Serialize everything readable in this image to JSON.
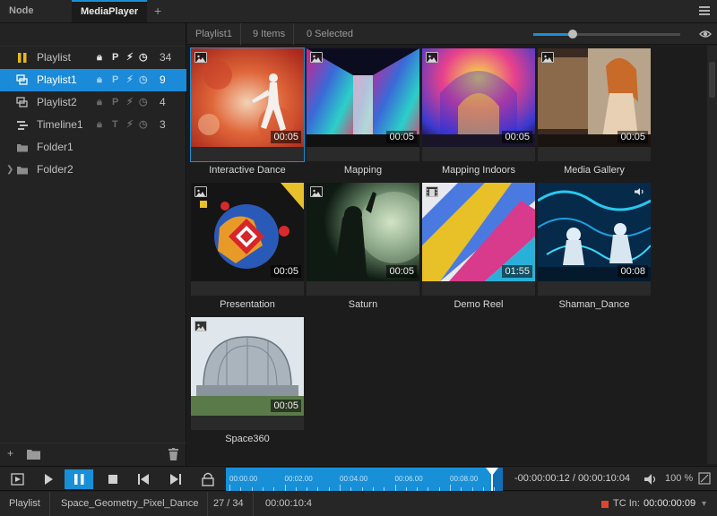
{
  "tabs": [
    {
      "label": "Node Graph"
    },
    {
      "label": "MediaPlayer"
    }
  ],
  "tab_add_label": "+",
  "sidebar": {
    "items": [
      {
        "label": "Playlist",
        "flags": [
          "lock",
          "P",
          "bolt",
          "clock"
        ],
        "count": "34"
      },
      {
        "label": "Playlist1",
        "flags": [
          "lock",
          "P",
          "bolt",
          "clock"
        ],
        "count": "9"
      },
      {
        "label": "Playlist2",
        "flags": [
          "lock",
          "P",
          "bolt",
          "clock"
        ],
        "count": "4"
      },
      {
        "label": "Timeline1",
        "flags": [
          "lock",
          "T",
          "bolt",
          "clock"
        ],
        "count": "3"
      },
      {
        "label": "Folder1"
      },
      {
        "label": "Folder2"
      }
    ],
    "footer_add": "+"
  },
  "header": {
    "playlist": "Playlist1",
    "items": "9 Items",
    "selected": "0 Selected",
    "thumb_size_level": 0.27
  },
  "media": [
    {
      "title": "Interactive Dance",
      "duration": "00:05",
      "kind": "image-icon"
    },
    {
      "title": "Mapping",
      "duration": "00:05",
      "kind": "image-icon"
    },
    {
      "title": "Mapping Indoors",
      "duration": "00:05",
      "kind": "image-icon"
    },
    {
      "title": "Media Gallery",
      "duration": "00:05",
      "kind": "image-icon"
    },
    {
      "title": "Presentation",
      "duration": "00:05",
      "kind": "image-icon"
    },
    {
      "title": "Saturn",
      "duration": "00:05",
      "kind": "image-icon"
    },
    {
      "title": "Demo Reel",
      "duration": "01:55",
      "kind": "film-icon"
    },
    {
      "title": "Shaman_Dance",
      "duration": "00:08",
      "kind": "audio-icon"
    },
    {
      "title": "Space360",
      "duration": "00:05",
      "kind": "image-icon"
    }
  ],
  "transport": {
    "ticks": [
      "00:00.00",
      "00:02.00",
      "00:04.00",
      "00:06.00",
      "00:08.00"
    ],
    "progress": 0.96,
    "timecode": "-00:00:00:12 / 00:00:10:04",
    "volume": "100 %"
  },
  "status": {
    "mode": "Playlist",
    "clip": "Space_Geometry_Pixel_Dance",
    "position": "27 / 34",
    "duration": "00:00:10:4",
    "tc_in_label": "TC In:",
    "tc_in_value": "00:00:00:09"
  },
  "colors": {
    "accent": "#1890d8",
    "record": "#e0442e",
    "playlist_icon": "#e8b81a"
  }
}
